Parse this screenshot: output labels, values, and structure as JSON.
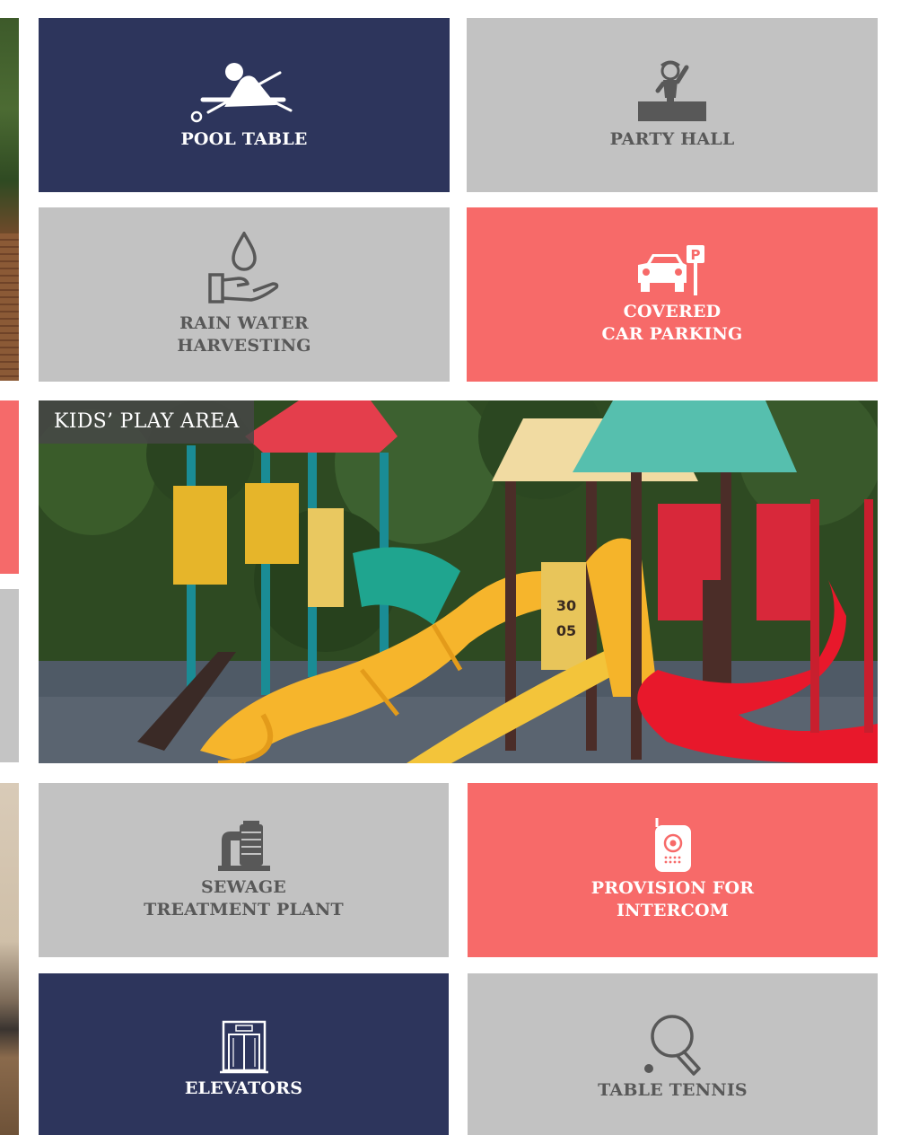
{
  "amenities": {
    "pool_table": {
      "label": "POOL TABLE",
      "icon": "pool-table-icon"
    },
    "party_hall": {
      "label": "PARTY HALL",
      "icon": "party-hall-icon"
    },
    "rain_water": {
      "line1": "RAIN WATER",
      "line2": "HARVESTING",
      "icon": "water-drop-hand-icon"
    },
    "parking": {
      "line1": "COVERED",
      "line2": "CAR PARKING",
      "icon": "car-parking-icon"
    },
    "kids": {
      "label": "KIDS’ PLAY AREA"
    },
    "sewage": {
      "line1": "SEWAGE",
      "line2": "TREATMENT PLANT",
      "icon": "sewage-plant-icon"
    },
    "intercom": {
      "line1": "PROVISION FOR",
      "line2": "INTERCOM",
      "icon": "intercom-icon"
    },
    "elevators": {
      "label": "ELEVATORS",
      "icon": "elevator-icon"
    },
    "table_tennis": {
      "label": "TABLE TENNIS",
      "icon": "table-tennis-icon"
    }
  },
  "colors": {
    "navy": "#2d355c",
    "gray": "#c2c2c2",
    "coral": "#f76a69",
    "gray_text": "#585858"
  }
}
